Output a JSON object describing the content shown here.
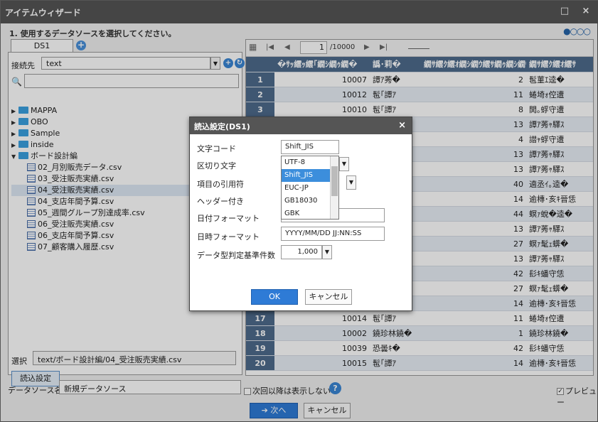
{
  "window": {
    "title": "アイテムウィザード",
    "minimize": "□",
    "close": "×",
    "step_text": "1. 使用するデータソースを選択してください。",
    "step_dots": "●○○○"
  },
  "left": {
    "tab_label": "DS1",
    "tab_add": "+",
    "connection_label": "接続先",
    "connection_value": "text",
    "tree": {
      "folders": [
        "MAPPA",
        "OBO",
        "Sample",
        "inside"
      ],
      "open_folder": "ボード設計編",
      "files": [
        "02_月別販売データ.csv",
        "03_受注販売実績.csv",
        "04_受注販売実績.csv",
        "04_支店年間予算.csv",
        "05_週間グループ別達成率.csv",
        "06_受注販売実績.csv",
        "06_支店年間予算.csv",
        "07_顧客購入履歴.csv"
      ]
    },
    "selection_label": "選択",
    "selection_value": "text/ボード設計編/04_受注販売実績.csv",
    "read_settings_button": "読込設定"
  },
  "grid": {
    "page_current": "1",
    "page_total": "/10000",
    "columns": [
      "�ｻｯ繧ｯ繧｢繝ｼ繝ｩ繝�",
      "譌･莉�",
      "繝ｻ繧ｸ繧ｵ繝ｼ繝ｳ繧ｻ繝ｩ繝ｼ繝ｳ�",
      "繝ｻ繧ｸ繧ｵ繧ｻ"
    ],
    "rows": [
      {
        "n": "1",
        "a": "10007",
        "b": "譚ｱ莠�",
        "c": "2",
        "d": "髢菫ｴ逵�"
      },
      {
        "n": "2",
        "a": "10012",
        "b": "髢｢譚ｱ",
        "c": "11",
        "d": "蜷埼ｫ倥遭"
      },
      {
        "n": "3",
        "a": "10010",
        "b": "髢｢譚ｱ",
        "c": "8",
        "d": "閧｡蜉守遭"
      },
      {
        "n": "4",
        "a": "",
        "b": "",
        "c": "13",
        "d": "譚ｱ莠ｬ驛ｽ"
      },
      {
        "n": "5",
        "a": "",
        "b": "",
        "c": "4",
        "d": "譛ｬ蜉守遭"
      },
      {
        "n": "6",
        "a": "",
        "b": "",
        "c": "13",
        "d": "譚ｱ莠ｬ驛ｽ"
      },
      {
        "n": "7",
        "a": "",
        "b": "",
        "c": "13",
        "d": "譚ｱ莠ｬ驛ｽ"
      },
      {
        "n": "8",
        "a": "",
        "b": "",
        "c": "40",
        "d": "遖丞ｲ｡逵�"
      },
      {
        "n": "9",
        "a": "",
        "b": "",
        "c": "14",
        "d": "逾槫･亥ｷ晉恁"
      },
      {
        "n": "10",
        "a": "",
        "b": "",
        "c": "44",
        "d": "螟ｧ蛻�逵�"
      },
      {
        "n": "11",
        "a": "",
        "b": "",
        "c": "13",
        "d": "譚ｱ莠ｬ驛ｽ"
      },
      {
        "n": "12",
        "a": "",
        "b": "",
        "c": "27",
        "d": "螟ｧ髦ｪ蠎�"
      },
      {
        "n": "13",
        "a": "",
        "b": "",
        "c": "13",
        "d": "譚ｱ莠ｬ驛ｽ"
      },
      {
        "n": "14",
        "a": "",
        "b": "",
        "c": "42",
        "d": "髟ｷ蟠守恁"
      },
      {
        "n": "15",
        "a": "",
        "b": "",
        "c": "27",
        "d": "螟ｧ髦ｪ蠎�"
      },
      {
        "n": "16",
        "a": "10015",
        "b": "髢｢譚ｱ",
        "c": "14",
        "d": "逾槫･亥ｷ晉恁"
      },
      {
        "n": "17",
        "a": "10014",
        "b": "髢｢譚ｱ",
        "c": "11",
        "d": "蜷埼ｫ倥遭"
      },
      {
        "n": "18",
        "a": "10002",
        "b": "鐃珍林鐃�",
        "c": "1",
        "d": "鐃珍林鐃�"
      },
      {
        "n": "19",
        "a": "10039",
        "b": "恐曇ｷ�",
        "c": "42",
        "d": "髟ｷ蟠守恁"
      },
      {
        "n": "20",
        "a": "10015",
        "b": "髢｢譚ｱ",
        "c": "14",
        "d": "逾槫･亥ｷ晉恁"
      }
    ]
  },
  "bottom": {
    "datasource_label": "データソース名",
    "datasource_value": "新規データソース",
    "dont_show_again": "次回以降は表示しない",
    "preview": "プレビュー",
    "next_button": "次へ",
    "cancel_button": "キャンセル"
  },
  "dialog": {
    "title": "読込設定(DS1)",
    "close": "×",
    "fields": {
      "charset_label": "文字コード",
      "charset_value": "Shift_JIS",
      "delimiter_label": "区切り文字",
      "quote_label": "項目の引用符",
      "header_label": "ヘッダー付き",
      "date_format_label": "日付フォーマット",
      "datetime_format_label": "日時フォーマット",
      "datetime_format_value": "YYYY/MM/DD JJ:NN:SS",
      "type_threshold_label": "データ型判定基準件数",
      "type_threshold_value": "1,000"
    },
    "charset_options": [
      "UTF-8",
      "Shift_JIS",
      "EUC-JP",
      "GB18030",
      "GBK"
    ],
    "ok_button": "OK",
    "cancel_button": "キャンセル"
  }
}
